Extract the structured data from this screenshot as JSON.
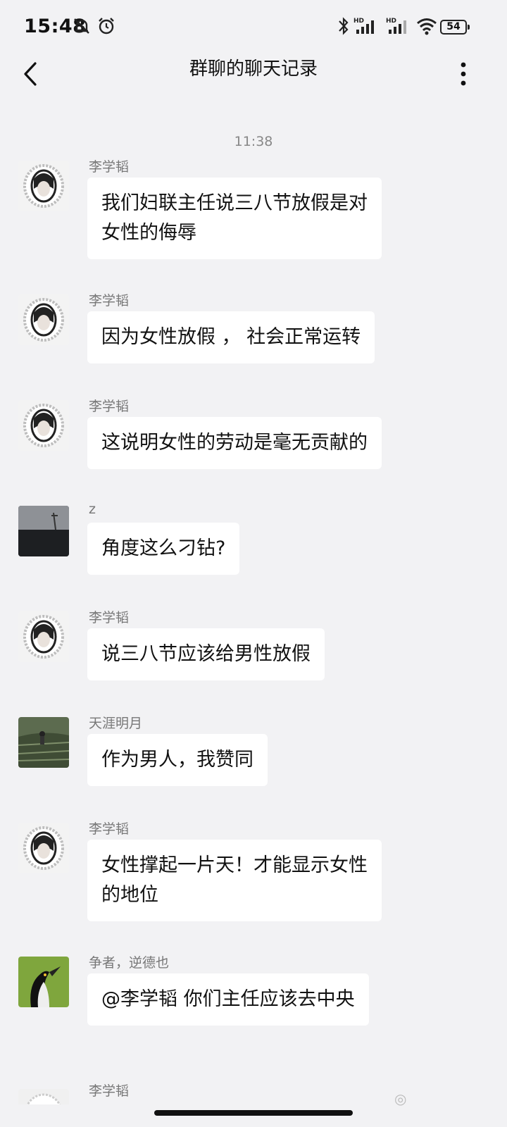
{
  "status_bar": {
    "time": "15:48",
    "battery": "54",
    "signal_label": "HD",
    "icons": [
      "bell-off-icon",
      "alarm-icon",
      "bluetooth-icon",
      "signal-hd-icon",
      "signal-hd-icon",
      "wifi-icon",
      "battery-icon"
    ]
  },
  "header": {
    "title": "群聊的聊天记录",
    "back_icon": "chevron-left-icon",
    "more_icon": "more-vertical-icon"
  },
  "timestamp": "11:38",
  "messages": [
    {
      "sender": "李学韬",
      "text": "我们妇联主任说三八节放假是对\n女性的侮辱",
      "avatar": "avatar-li"
    },
    {
      "sender": "李学韬",
      "text": "因为女性放假 ， 社会正常运转",
      "avatar": "avatar-li"
    },
    {
      "sender": "李学韬",
      "text": "这说明女性的劳动是毫无贡献的",
      "avatar": "avatar-li"
    },
    {
      "sender": "z",
      "text": "角度这么刁钻?",
      "avatar": "avatar-z"
    },
    {
      "sender": "李学韬",
      "text": "说三八节应该给男性放假",
      "avatar": "avatar-li"
    },
    {
      "sender": "天涯明月",
      "text": "作为男人，我赞同",
      "avatar": "avatar-tianya"
    },
    {
      "sender": "李学韬",
      "text": "女性撑起一片天！才能显示女性\n的地位",
      "avatar": "avatar-li"
    },
    {
      "sender": "争者，逆德也",
      "text": "@李学韬 你们主任应该去中央",
      "avatar": "avatar-penguin"
    }
  ],
  "partial_sender": "李学韬",
  "colors": {
    "background": "#f2f2f4",
    "bubble": "#ffffff",
    "text": "#111111",
    "meta": "#888888"
  }
}
